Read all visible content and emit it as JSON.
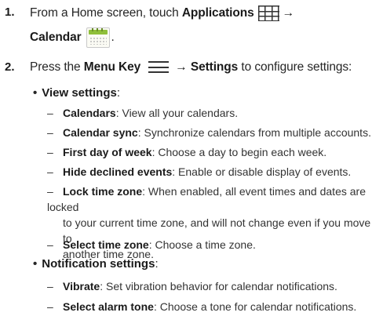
{
  "steps": [
    {
      "number": "1.",
      "parts": {
        "text_a": "From a Home screen, touch ",
        "bold_a": "Applications",
        "icon_a": "applications-grid-icon",
        "arrow": "→",
        "bold_b": "Calendar",
        "icon_b": "calendar-app-icon",
        "tail": "."
      }
    },
    {
      "number": "2.",
      "parts": {
        "text_a": "Press the ",
        "bold_a": "Menu Key",
        "icon_a": "menu-key-icon",
        "arrow": "→",
        "bold_b": "Settings",
        "tail": " to configure settings:"
      }
    }
  ],
  "view_settings": {
    "bullet": "•",
    "label": "View settings",
    "suffix": ":",
    "items": [
      {
        "dash": "–",
        "term": "Calendars",
        "desc": ": View all your calendars."
      },
      {
        "dash": "–",
        "term": "Calendar sync",
        "desc": ": Synchronize calendars from multiple accounts."
      },
      {
        "dash": "–",
        "term": "First day of week",
        "desc": ": Choose a day to begin each week."
      },
      {
        "dash": "–",
        "term": "Hide declined events",
        "desc": ": Enable or disable display of events."
      },
      {
        "dash": "–",
        "term": "Lock time zone",
        "desc": ": When enabled, all event times and dates are locked",
        "cont1": "to your current time zone, and will not change even if you move to",
        "cont2": "another time zone."
      },
      {
        "dash": "–",
        "term": "Select time zone",
        "desc": ": Choose a time zone."
      }
    ]
  },
  "notification_settings": {
    "bullet": "•",
    "label": "Notification settings",
    "suffix": ":",
    "items": [
      {
        "dash": "–",
        "term": "Vibrate",
        "desc": ": Set vibration behavior for calendar notifications."
      },
      {
        "dash": "–",
        "term": "Select alarm tone",
        "desc": ": Choose a tone for calendar notifications."
      }
    ]
  }
}
